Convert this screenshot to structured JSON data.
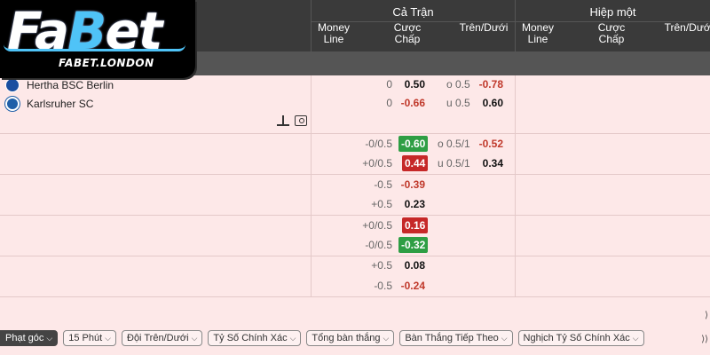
{
  "logo": {
    "word_fa": "Fa",
    "word_b": "B",
    "word_et": "et",
    "sub": "FABET.LONDON"
  },
  "header": {
    "full_match": {
      "title": "Cả Trận",
      "cols": [
        {
          "l1": "Money",
          "l2": "Line"
        },
        {
          "l1": "Cược",
          "l2": "Chấp"
        },
        {
          "l1": "Trên/Dưới",
          "l2": ""
        }
      ]
    },
    "first_half": {
      "title": "Hiệp một",
      "cols": [
        {
          "l1": "Money",
          "l2": "Line"
        },
        {
          "l1": "Cược",
          "l2": "Chấp"
        },
        {
          "l1": "Trên/Dưới",
          "l2": ""
        }
      ]
    }
  },
  "match": {
    "home": "Hertha BSC Berlin",
    "away": "Karlsruher SC"
  },
  "rows": [
    {
      "hcap": "0",
      "odd": "0.50",
      "odd_style": "pos",
      "ou_label": "o 0.5",
      "ou_odd": "-0.78",
      "ou_style": "neg"
    },
    {
      "hcap": "0",
      "odd": "-0.66",
      "odd_style": "neg",
      "ou_label": "u 0.5",
      "ou_odd": "0.60",
      "ou_style": "pos"
    },
    {
      "hcap": "-0/0.5",
      "odd": "-0.60",
      "odd_style": "up",
      "ou_label": "o 0.5/1",
      "ou_odd": "-0.52",
      "ou_style": "neg"
    },
    {
      "hcap": "+0/0.5",
      "odd": "0.44",
      "odd_style": "down",
      "ou_label": "u 0.5/1",
      "ou_odd": "0.34",
      "ou_style": "pos"
    },
    {
      "hcap": "-0.5",
      "odd": "-0.39",
      "odd_style": "neg",
      "ou_label": "",
      "ou_odd": "",
      "ou_style": ""
    },
    {
      "hcap": "+0.5",
      "odd": "0.23",
      "odd_style": "pos",
      "ou_label": "",
      "ou_odd": "",
      "ou_style": ""
    },
    {
      "hcap": "+0/0.5",
      "odd": "0.16",
      "odd_style": "down",
      "ou_label": "",
      "ou_odd": "",
      "ou_style": ""
    },
    {
      "hcap": "-0/0.5",
      "odd": "-0.32",
      "odd_style": "up",
      "ou_label": "",
      "ou_odd": "",
      "ou_style": ""
    },
    {
      "hcap": "+0.5",
      "odd": "0.08",
      "odd_style": "pos",
      "ou_label": "",
      "ou_odd": "",
      "ou_style": ""
    },
    {
      "hcap": "-0.5",
      "odd": "-0.24",
      "odd_style": "neg",
      "ou_label": "",
      "ou_odd": "",
      "ou_style": ""
    }
  ],
  "filters": [
    {
      "label": "Phạt góc",
      "active": true
    },
    {
      "label": "15 Phút",
      "active": false
    },
    {
      "label": "Đội Trên/Dưới",
      "active": false
    },
    {
      "label": "Tỷ Số Chính Xác",
      "active": false
    },
    {
      "label": "Tổng bàn thắng",
      "active": false
    },
    {
      "label": "Bàn Thắng Tiếp Theo",
      "active": false
    },
    {
      "label": "Nghịch Tỷ Số Chính Xác",
      "active": false
    }
  ],
  "icons": {
    "chevron": "chevron-down-icon",
    "stats": "stats-icon",
    "live": "live-view-icon"
  },
  "colors": {
    "header_bg": "#3a3a3a",
    "row_bg": "#fde8e8",
    "odd_up": "#2e9e44",
    "odd_down": "#c62828",
    "negative_text": "#c0392b"
  }
}
